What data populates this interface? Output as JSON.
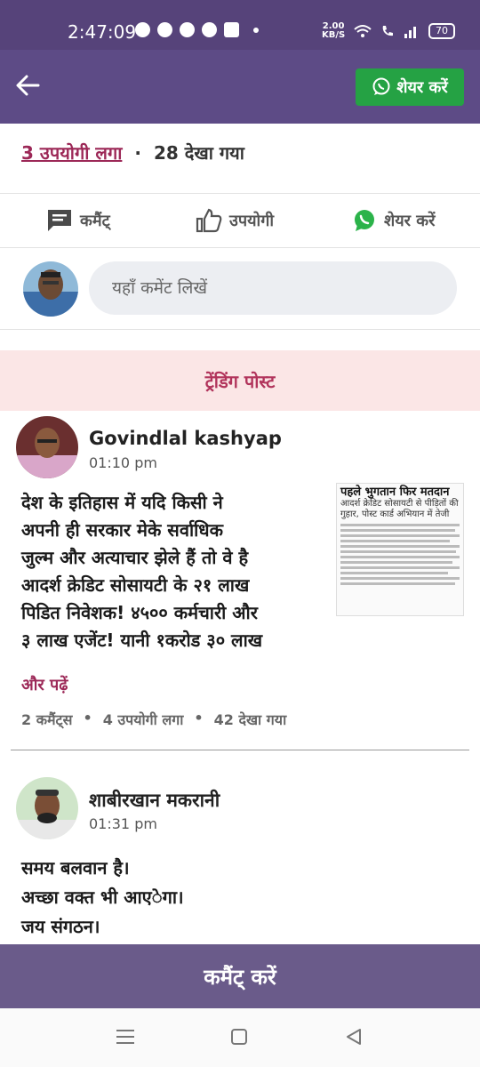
{
  "status_bar": {
    "time": "2:47:09",
    "speed_value": "2.00",
    "speed_unit": "KB/S",
    "battery": "70"
  },
  "header": {
    "share_label": "शेयर करें"
  },
  "stats": {
    "useful": "3 उपयोगी लगा",
    "views": "28 देखा गया"
  },
  "actions": {
    "comment": "कमैंट्",
    "useful": "उपयोगी",
    "share": "शेयर करें"
  },
  "comment_box": {
    "placeholder": "यहाँ कमेंट लिखें"
  },
  "trending": {
    "title": "ट्रेंडिंग पोस्ट"
  },
  "posts": [
    {
      "author": "Govindlal kashyap",
      "time": "01:10 pm",
      "lines": [
        "देश के इतिहास में यदि किसी ने",
        "अपनी ही सरकार मेके सर्वाधिक",
        "जुल्म और अत्याचार झेले हैं तो वे है",
        "आदर्श क्रेडिट सोसायटी के २१ लाख",
        "पिडित निवेशक! ४५०० कर्मचारी और",
        "३ लाख एजेंट! यानी १करोड ३० लाख"
      ],
      "read_more": "और पढ़ें",
      "comments": "2 कमैंट्स",
      "useful": "4 उपयोगी लगा",
      "views": "42 देखा गया",
      "clip": {
        "headline": "पहले भुगतान फिर मतदान",
        "subheadline": "आदर्श क्रेडिट सोसायटी से पीड़ितों की गुहार, पोस्ट कार्ड अभियान में तेजी"
      }
    },
    {
      "author": "शाबीरखान मकरानी",
      "time": "01:31 pm",
      "lines": [
        "समय बलवान है।",
        "अच्छा वक्त भी आएेगा।",
        "जय संगठन।"
      ]
    }
  ],
  "bottom_cta": {
    "label": "कमैंट् करें"
  },
  "colors": {
    "status_bar": "#56437a",
    "app_bar": "#5d4b86",
    "whatsapp": "#25a244",
    "accent": "#9c2857",
    "trending_bg": "#fbe6e6",
    "cta": "#6a5b8a"
  }
}
